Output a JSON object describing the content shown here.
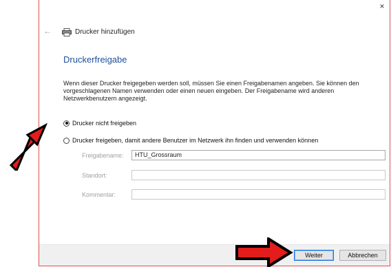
{
  "window": {
    "close_glyph": "×",
    "back_glyph": "←",
    "title": "Drucker hinzufügen"
  },
  "page": {
    "heading": "Druckerfreigabe",
    "description": "Wenn dieser Drucker freigegeben werden soll, müssen Sie einen Freigabenamen angeben. Sie können den vorgeschlagenen Namen verwenden oder einen neuen eingeben. Der Freigabename wird anderen Netzwerkbenutzern angezeigt."
  },
  "options": {
    "no_share": {
      "label": "Drucker nicht freigeben",
      "selected": true
    },
    "share": {
      "label": "Drucker freigeben, damit andere Benutzer im Netzwerk ihn finden und verwenden können",
      "selected": false
    }
  },
  "fields": {
    "share_name": {
      "label": "Freigabename:",
      "value": "HTU_Grossraum"
    },
    "location": {
      "label": "Standort:",
      "value": ""
    },
    "comment": {
      "label": "Kommentar:",
      "value": ""
    }
  },
  "buttons": {
    "next": "Weiter",
    "cancel": "Abbrechen"
  },
  "colors": {
    "heading": "#1e4f9c",
    "annotation_arrow_fill": "#e31c1c",
    "annotation_arrow_outline": "#000000",
    "window_border": "#d9534f"
  },
  "icons": {
    "printer": "printer-icon",
    "back": "back-arrow-icon",
    "close": "close-icon",
    "annotation": "red-arrow-icon"
  }
}
